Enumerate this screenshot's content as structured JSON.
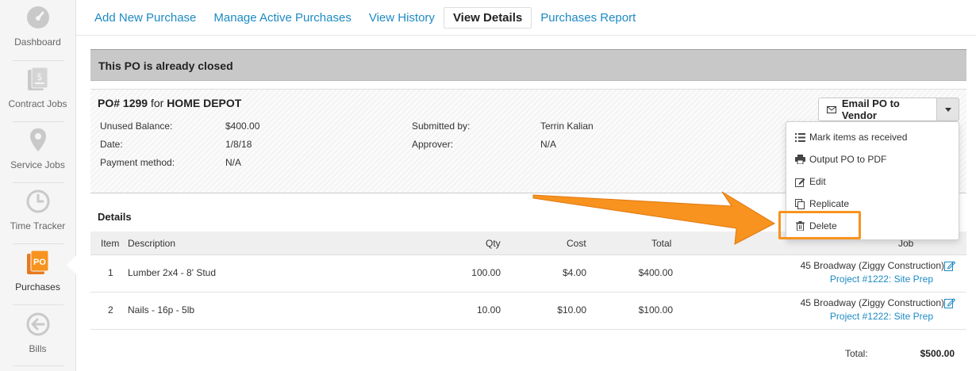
{
  "sidebar": {
    "items": [
      {
        "label": "Dashboard",
        "icon": "gauge-icon"
      },
      {
        "label": "Contract Jobs",
        "icon": "contract-document-icon"
      },
      {
        "label": "Service Jobs",
        "icon": "map-pin-icon"
      },
      {
        "label": "Time Tracker",
        "icon": "clock-icon"
      },
      {
        "label": "Purchases",
        "icon": "po-icon",
        "badge": "PO",
        "active": true
      },
      {
        "label": "Bills",
        "icon": "arrow-left-circle-icon"
      }
    ]
  },
  "tabs": [
    {
      "label": "Add New Purchase"
    },
    {
      "label": "Manage Active Purchases"
    },
    {
      "label": "View History"
    },
    {
      "label": "View Details",
      "current": true
    },
    {
      "label": "Purchases Report"
    }
  ],
  "banner": "This PO is already closed",
  "po": {
    "number": "PO# 1299",
    "for_word": "for",
    "vendor": "HOME DEPOT",
    "fields": [
      {
        "label": "Unused Balance:",
        "value": "$400.00"
      },
      {
        "label": "Date:",
        "value": "1/8/18"
      },
      {
        "label": "Payment method:",
        "value": "N/A"
      },
      {
        "label": "Submitted by:",
        "value": "Terrin Kalian"
      },
      {
        "label": "Approver:",
        "value": "N/A"
      }
    ]
  },
  "actions": {
    "email_label": "Email PO to Vendor",
    "menu": [
      {
        "label": "Mark items as received",
        "icon": "list-icon"
      },
      {
        "label": "Output PO to PDF",
        "icon": "printer-icon"
      },
      {
        "label": "Edit",
        "icon": "edit-icon"
      },
      {
        "label": "Replicate",
        "icon": "copy-icon"
      },
      {
        "label": "Delete",
        "icon": "trash-icon"
      }
    ]
  },
  "details": {
    "title": "Details",
    "columns": {
      "item": "Item",
      "description": "Description",
      "qty": "Qty",
      "cost": "Cost",
      "total": "Total",
      "job": "Job"
    },
    "rows": [
      {
        "item": "1",
        "description": "Lumber 2x4 - 8' Stud",
        "qty": "100.00",
        "cost": "$4.00",
        "total": "$400.00",
        "job_name": "45 Broadway (Ziggy Construction)",
        "job_link": "Project #1222: Site Prep"
      },
      {
        "item": "2",
        "description": "Nails - 16p - 5lb",
        "qty": "10.00",
        "cost": "$10.00",
        "total": "$100.00",
        "job_name": "45 Broadway (Ziggy Construction)",
        "job_link": "Project #1222: Site Prep"
      }
    ],
    "total_label": "Total:",
    "total_value": "$500.00"
  },
  "colors": {
    "link": "#1d8ac4",
    "accent": "#f7931e",
    "banner": "#c8c8c8"
  }
}
